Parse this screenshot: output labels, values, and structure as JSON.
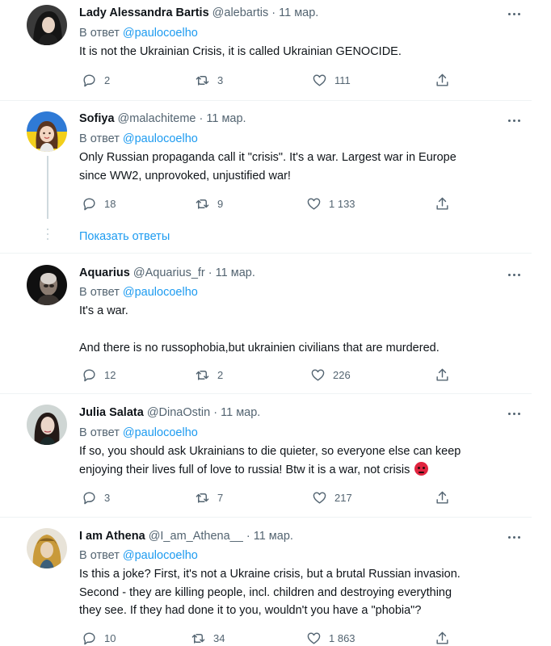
{
  "tweets": [
    {
      "name": "Lady Alessandra Bartis",
      "handle": "@alebartis",
      "date": "11 мар.",
      "reply_prefix": "В ответ",
      "reply_to": "@paulocoelho",
      "text": [
        "It is not the Ukrainian Crisis, it is called Ukrainian GENOCIDE."
      ],
      "replies": "2",
      "retweets": "3",
      "likes": "111"
    },
    {
      "name": "Sofiya",
      "handle": "@malachiteme",
      "date": "11 мар.",
      "reply_prefix": "В ответ",
      "reply_to": "@paulocoelho",
      "text": [
        "Only Russian propaganda call it \"crisis\". It's a war. Largest war in Europe",
        "since WW2, unprovoked, unjustified war!"
      ],
      "replies": "18",
      "retweets": "9",
      "likes": "1 133",
      "show_replies": "Показать ответы"
    },
    {
      "name": "Aquarius",
      "handle": "@Aquarius_fr",
      "date": "11 мар.",
      "reply_prefix": "В ответ",
      "reply_to": "@paulocoelho",
      "text": [
        "It's a war.",
        "And there is no russophobia,but ukrainien civilians that are murdered."
      ],
      "replies": "12",
      "retweets": "2",
      "likes": "226"
    },
    {
      "name": "Julia Salata",
      "handle": "@DinaOstin",
      "date": "11 мар.",
      "reply_prefix": "В ответ",
      "reply_to": "@paulocoelho",
      "text": [
        "If so, you should ask Ukrainians to die quieter, so everyone else can keep",
        "enjoying their lives full of love to russia! Btw it is a war, not crisis"
      ],
      "replies": "3",
      "retweets": "7",
      "likes": "217"
    },
    {
      "name": "I am Athena",
      "handle": "@I_am_Athena__",
      "date": "11 мар.",
      "reply_prefix": "В ответ",
      "reply_to": "@paulocoelho",
      "text": [
        "Is this a joke? First, it's not a Ukraine crisis, but a brutal Russian invasion.",
        "Second - they are killing people, incl. children and destroying everything",
        "they see. If they had done it to you, wouldn't you have a \"phobia\"?"
      ],
      "replies": "10",
      "retweets": "34",
      "likes": "1 863"
    }
  ],
  "icons": {
    "reply": "reply-icon",
    "retweet": "retweet-icon",
    "like": "heart-icon",
    "share": "share-icon",
    "more": "more-icon",
    "emoji": "angry-face-emoji"
  },
  "colors": {
    "link": "#1d9bf0",
    "secondary": "#536471",
    "divider": "#eff3f4",
    "text": "#0f1419"
  }
}
